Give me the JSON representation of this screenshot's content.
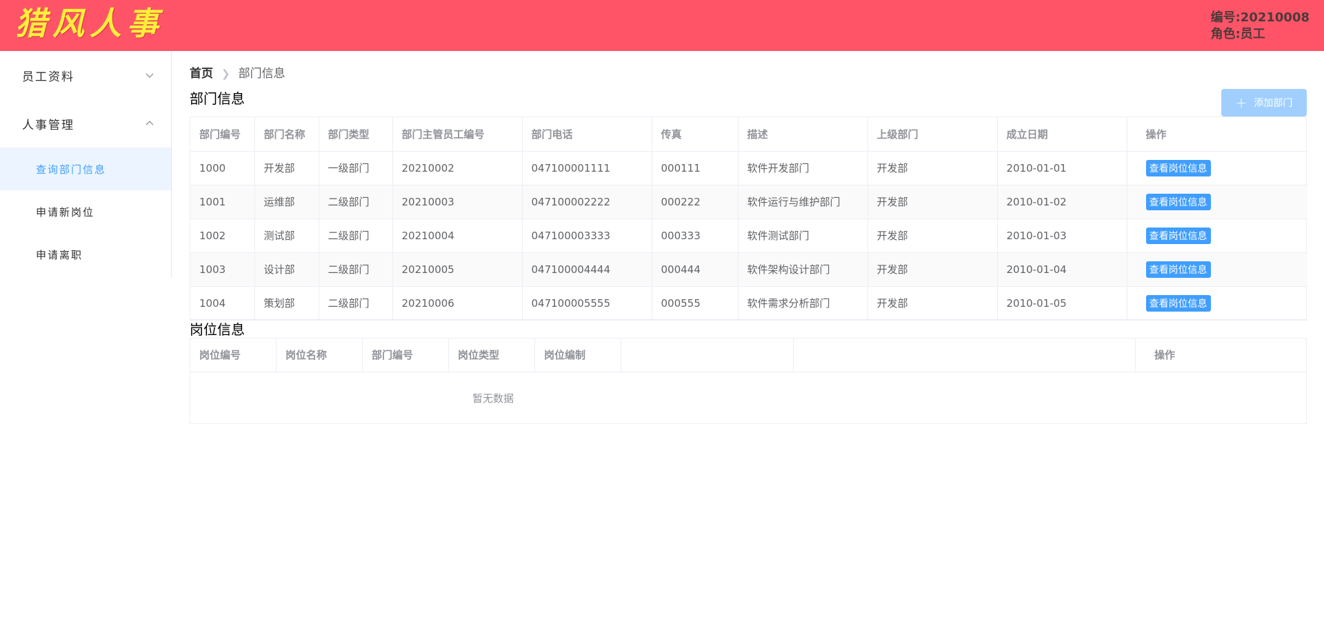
{
  "header": {
    "logo": "猎风人事",
    "user_id_label": "编号:20210008",
    "user_role_label": "角色:员工",
    "bg_color": "#ff5468",
    "logo_color": "#ffee3a"
  },
  "sidebar": {
    "groups": [
      {
        "label": "员工资料",
        "expanded": false,
        "icon": "chevron-down-icon"
      },
      {
        "label": "人事管理",
        "expanded": true,
        "icon": "chevron-up-icon",
        "items": [
          {
            "label": "查询部门信息",
            "active": true
          },
          {
            "label": "申请新岗位",
            "active": false
          },
          {
            "label": "申请离职",
            "active": false
          }
        ]
      }
    ]
  },
  "breadcrumb": {
    "home": "首页",
    "current": "部门信息"
  },
  "department": {
    "title": "部门信息",
    "add_button": "添加部门",
    "columns": [
      "部门编号",
      "部门名称",
      "部门类型",
      "部门主管员工编号",
      "部门电话",
      "传真",
      "描述",
      "上级部门",
      "成立日期",
      "操作"
    ],
    "rows": [
      [
        "1000",
        "开发部",
        "一级部门",
        "20210002",
        "047100001111",
        "000111",
        "软件开发部门",
        "开发部",
        "2010-01-01"
      ],
      [
        "1001",
        "运维部",
        "二级部门",
        "20210003",
        "047100002222",
        "000222",
        "软件运行与维护部门",
        "开发部",
        "2010-01-02"
      ],
      [
        "1002",
        "测试部",
        "二级部门",
        "20210004",
        "047100003333",
        "000333",
        "软件测试部门",
        "开发部",
        "2010-01-03"
      ],
      [
        "1003",
        "设计部",
        "二级部门",
        "20210005",
        "047100004444",
        "000444",
        "软件架构设计部门",
        "开发部",
        "2010-01-04"
      ],
      [
        "1004",
        "策划部",
        "二级部门",
        "20210006",
        "047100005555",
        "000555",
        "软件需求分析部门",
        "开发部",
        "2010-01-05"
      ]
    ],
    "row_action": "查看岗位信息"
  },
  "position": {
    "title": "岗位信息",
    "columns": [
      "岗位编号",
      "岗位名称",
      "部门编号",
      "岗位类型",
      "岗位编制"
    ],
    "action_column": "操作",
    "empty_text": "暂无数据"
  }
}
